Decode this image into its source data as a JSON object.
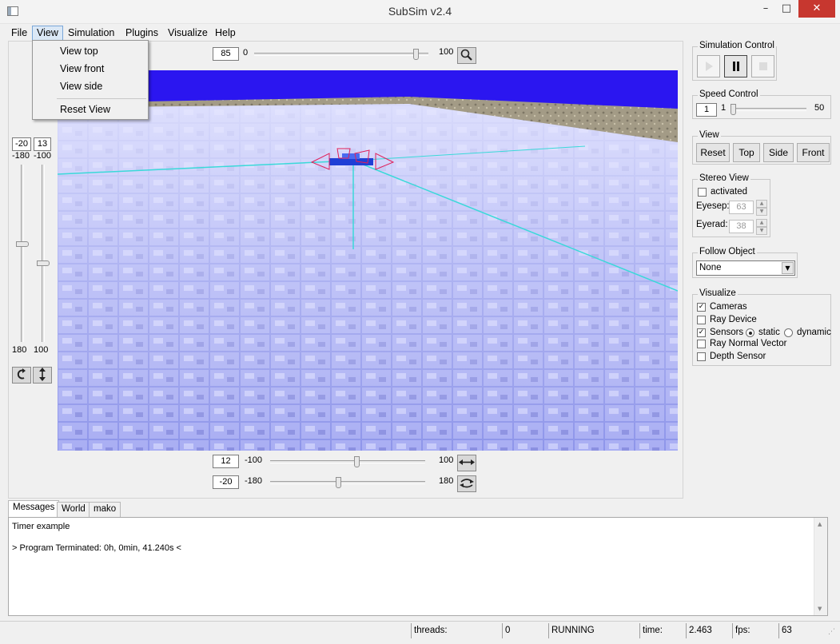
{
  "window": {
    "title": "SubSim v2.4",
    "minimize_glyph": "–",
    "maximize_glyph": "□",
    "close_glyph": "✕"
  },
  "menu": {
    "items": [
      "File",
      "View",
      "Simulation",
      "Plugins",
      "Visualize",
      "Help"
    ]
  },
  "view_menu": {
    "items": [
      "View top",
      "View front",
      "View side",
      "Reset View"
    ]
  },
  "top_zoom": {
    "value": "85",
    "min": "0",
    "max": "100",
    "level": 0.93,
    "icon": "magnifier-icon"
  },
  "left_sliders": {
    "field_a": "-20",
    "field_b": "13",
    "slider_a": {
      "min": "-180",
      "max": "180",
      "level": 0.45
    },
    "slider_b": {
      "min": "-100",
      "max": "100",
      "level": 0.56
    },
    "icons": [
      "rotate-icon",
      "vertical-arrows-icon"
    ]
  },
  "bottom_sliders": {
    "row1": {
      "value": "12",
      "min": "-100",
      "max": "100",
      "level": 0.56,
      "icon": "horizontal-arrows-icon"
    },
    "row2": {
      "value": "-20",
      "min": "-180",
      "max": "180",
      "level": 0.44,
      "icon": "rotate-horizontal-icon"
    }
  },
  "simulation_control": {
    "title": "Simulation Control",
    "buttons": [
      "play",
      "pause",
      "stop"
    ]
  },
  "speed_control": {
    "title": "Speed Control",
    "value": "1",
    "min": "1",
    "max": "50",
    "level": 0.0
  },
  "view_group": {
    "title": "View",
    "buttons": [
      "Reset",
      "Top",
      "Side",
      "Front"
    ]
  },
  "stereo_view": {
    "title": "Stereo View",
    "activated_label": "activated",
    "eyesep_label": "Eyesep:",
    "eyesep_value": "63",
    "eyerad_label": "Eyerad:",
    "eyerad_value": "38"
  },
  "follow_object": {
    "title": "Follow Object",
    "selected": "None"
  },
  "visualize": {
    "title": "Visualize",
    "cameras": "Cameras",
    "ray_device": "Ray Device",
    "sensors": "Sensors",
    "static": "static",
    "dynamic": "dynamic",
    "ray_normal": "Ray Normal Vector",
    "depth_sensor": "Depth Sensor"
  },
  "tabs": [
    "Messages",
    "World",
    "mako"
  ],
  "messages": [
    "Timer example",
    "> Program Terminated: 0h, 0min, 41.240s <"
  ],
  "status": {
    "threads_label": "threads:",
    "threads_value": "0",
    "state": "RUNNING",
    "time_label": "time:",
    "time_value": "2.463",
    "fps_label": "fps:",
    "fps_value": "63"
  },
  "colors": {
    "water": "#9aa0ef",
    "sky": "#2b16f0",
    "wall": "#a89f8a",
    "close": "#c7372f",
    "robot": "#1f3fd6",
    "frustum": "#e0205a",
    "axis": "#3ad9d9"
  }
}
